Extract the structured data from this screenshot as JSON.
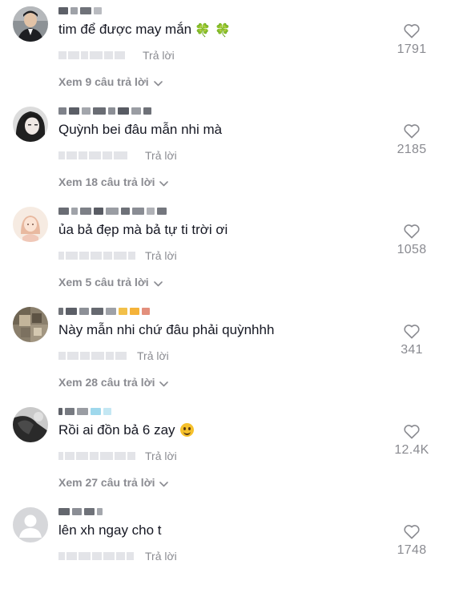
{
  "ui": {
    "reply_label": "Trả lời"
  },
  "comments": [
    {
      "text": "tim để được may mắn",
      "emoji": "🍀 🍀",
      "likes": "1791",
      "view_replies": "Xem 9 câu trả lời"
    },
    {
      "text": "Quỳnh bei đâu mẫn nhi mà",
      "likes": "2185",
      "view_replies": "Xem 18 câu trả lời"
    },
    {
      "text": "ủa bả đẹp mà bả tự ti trời ơi",
      "likes": "1058",
      "view_replies": "Xem 5 câu trả lời"
    },
    {
      "text": "Này mẫn nhi chứ đâu phải quỳnhhh",
      "likes": "341",
      "view_replies": "Xem 28 câu trả lời"
    },
    {
      "text": "Rồi ai đồn bả 6 zay",
      "likes": "12.4K",
      "view_replies": "Xem 27 câu trả lời"
    },
    {
      "text": "lên xh ngay cho t",
      "likes": "1748"
    }
  ],
  "icons": {
    "like": "heart-outline-icon",
    "expand": "chevron-down-icon",
    "default_avatar": "person-silhouette-icon"
  },
  "colors": {
    "text_primary": "#161823",
    "text_secondary": "#8a8b91",
    "background": "#ffffff",
    "blur_placeholder": "#e3e4e8"
  }
}
